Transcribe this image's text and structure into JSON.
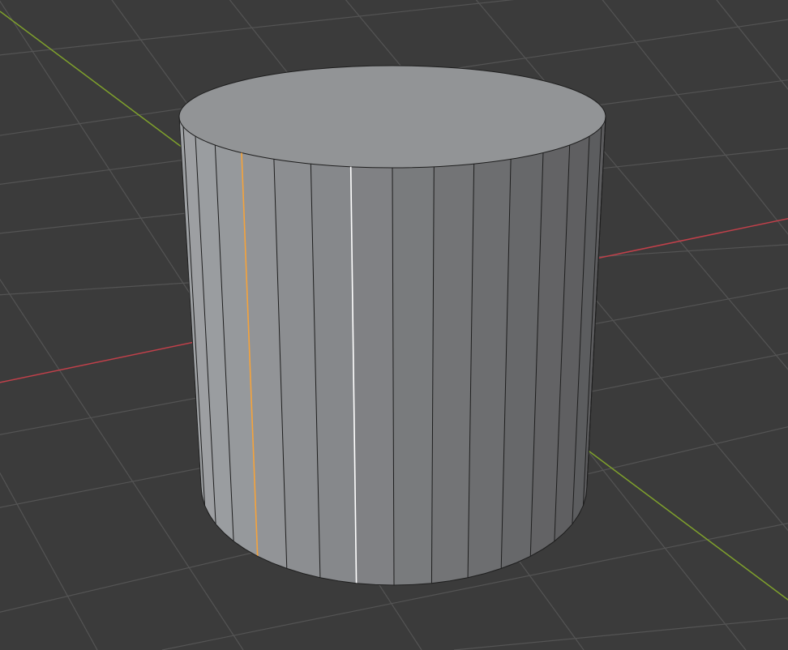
{
  "viewport": {
    "background": "#3b3b3b",
    "grid_color": "#545454",
    "x_axis_color": "#c0404a",
    "y_axis_color": "#7fa12c"
  },
  "mesh": {
    "object": "cylinder-icon",
    "segments": 32,
    "face_light": "#9ea1a4",
    "face_mid": "#8a8c8f",
    "face_dark": "#5b5b5d",
    "top_cap_color": "#929496",
    "edge_color": "#1e1e1e",
    "active_edge_color": "#f5a33b",
    "selected_edge_color": "#ffffff"
  }
}
